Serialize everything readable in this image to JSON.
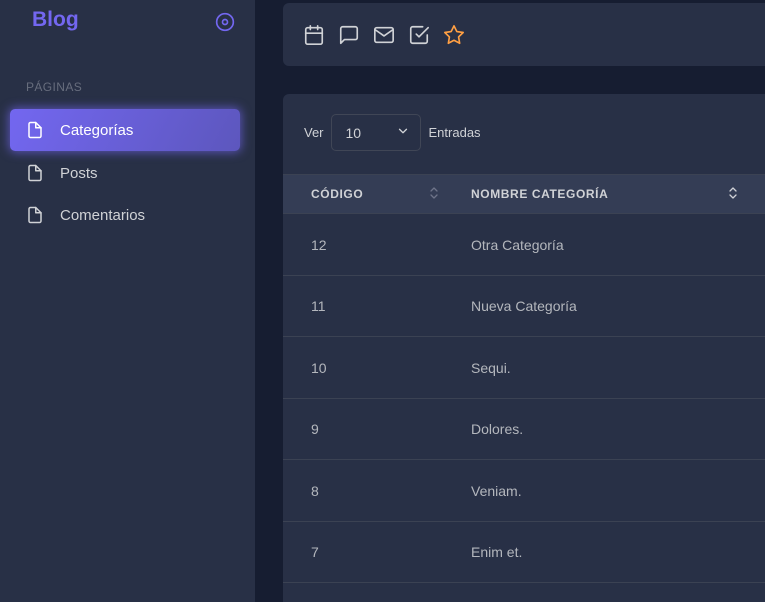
{
  "sidebar": {
    "brand": "Blog",
    "section_header": "PÁGINAS",
    "items": [
      {
        "label": "Categorías",
        "icon": "file-icon",
        "active": true
      },
      {
        "label": "Posts",
        "icon": "file-icon",
        "active": false
      },
      {
        "label": "Comentarios",
        "icon": "file-icon",
        "active": false
      }
    ],
    "toggle_icon": "disc-icon"
  },
  "navbar": {
    "icons": [
      "calendar-icon",
      "message-square-icon",
      "mail-icon",
      "check-square-icon",
      "star-icon"
    ]
  },
  "table": {
    "length_label_before": "Ver",
    "length_value": "10",
    "length_label_after": "Entradas",
    "columns": [
      "CÓDIGO",
      "NOMBRE CATEGORÍA"
    ],
    "rows": [
      {
        "code": "12",
        "name": "Otra Categoría"
      },
      {
        "code": "11",
        "name": "Nueva Categoría"
      },
      {
        "code": "10",
        "name": "Sequi."
      },
      {
        "code": "9",
        "name": "Dolores."
      },
      {
        "code": "8",
        "name": "Veniam."
      },
      {
        "code": "7",
        "name": "Enim et."
      }
    ]
  },
  "colors": {
    "primary": "#7367f0",
    "star": "#ff9f43",
    "sidebar_bg": "#283046",
    "body_bg": "#161d31"
  }
}
